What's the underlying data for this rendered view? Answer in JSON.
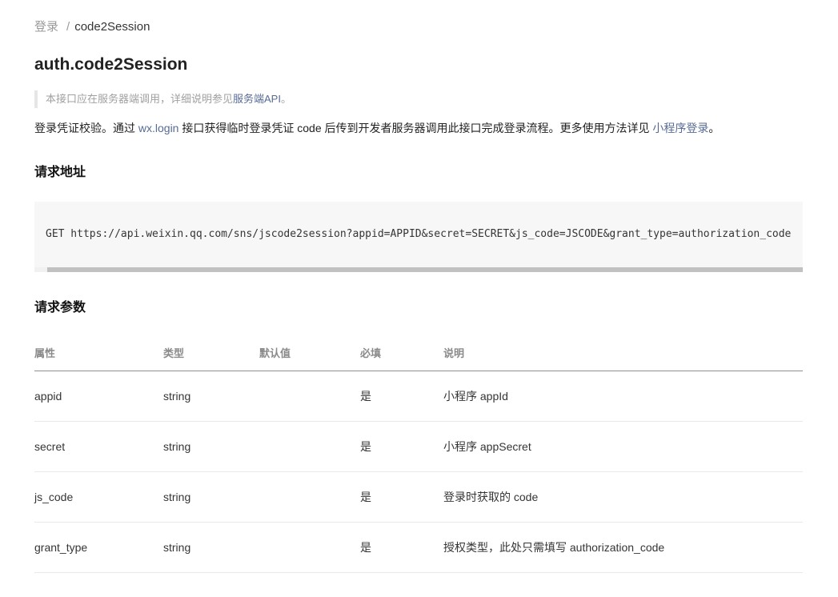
{
  "breadcrumb": {
    "parent": "登录",
    "separator": "/",
    "current": "code2Session"
  },
  "title": "auth.code2Session",
  "note": {
    "text": "本接口应在服务器端调用，详细说明参见",
    "link": "服务端API",
    "suffix": "。"
  },
  "intro": {
    "part1": "登录凭证校验。通过 ",
    "link1": "wx.login",
    "part2": " 接口获得临时登录凭证 code 后传到开发者服务器调用此接口完成登录流程。更多使用方法详见 ",
    "link2": "小程序登录",
    "part3": "。"
  },
  "request_address": {
    "heading": "请求地址",
    "code": "GET https://api.weixin.qq.com/sns/jscode2session?appid=APPID&secret=SECRET&js_code=JSCODE&grant_type=authorization_code"
  },
  "request_params": {
    "heading": "请求参数",
    "columns": [
      "属性",
      "类型",
      "默认值",
      "必填",
      "说明"
    ],
    "rows": [
      {
        "name": "appid",
        "type": "string",
        "default": "",
        "required": "是",
        "desc": "小程序 appId"
      },
      {
        "name": "secret",
        "type": "string",
        "default": "",
        "required": "是",
        "desc": "小程序 appSecret"
      },
      {
        "name": "js_code",
        "type": "string",
        "default": "",
        "required": "是",
        "desc": "登录时获取的 code"
      },
      {
        "name": "grant_type",
        "type": "string",
        "default": "",
        "required": "是",
        "desc": "授权类型，此处只需填写 authorization_code"
      }
    ]
  },
  "colors": {
    "link": "#576b95",
    "code_bg": "#f7f7f7",
    "muted": "#9a9a9a"
  }
}
